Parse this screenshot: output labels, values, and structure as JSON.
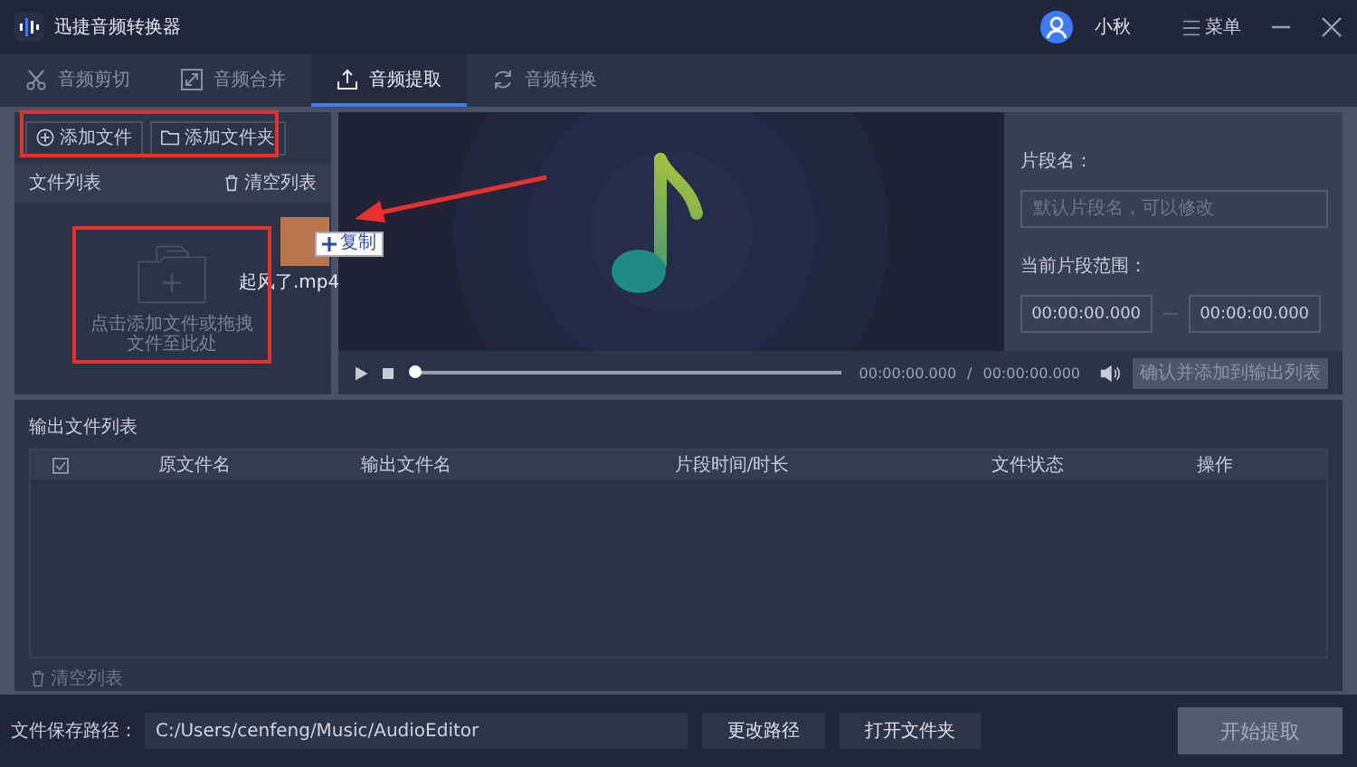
{
  "window": {
    "title": "迅捷音频转换器",
    "user": "小秋",
    "menu_label": "菜单"
  },
  "tabs": [
    {
      "label": "音频剪切",
      "kind": "scissors",
      "selected": false
    },
    {
      "label": "音频合并",
      "kind": "merge",
      "selected": false
    },
    {
      "label": "音频提取",
      "kind": "extract",
      "selected": true
    },
    {
      "label": "音频转换",
      "kind": "convert",
      "selected": false
    }
  ],
  "file_panel": {
    "buttons": [
      {
        "label": "添加文件",
        "kind": "file"
      },
      {
        "label": "添加文件夹",
        "kind": "folder"
      }
    ],
    "title": "文件列表",
    "clear": "清空列表",
    "dropzone_hint": "点击添加文件或拖拽文件至此处",
    "dragged_file": {
      "name": "起风了.mp4",
      "tooltip": "复制"
    }
  },
  "player": {
    "current_time": "00:00:00.000",
    "separator": "/",
    "total_time": "00:00:00.000",
    "progress": {
      "level": 0
    },
    "confirm_button": {
      "label": "确认并添加到输出列表",
      "disabled": true
    }
  },
  "segment": {
    "name_label": "片段名：",
    "name_field": {
      "placeholder": "默认片段名，可以修改"
    },
    "range_label": "当前片段范围：",
    "range_start": "00:00:00.000",
    "range_end": "00:00:00.000"
  },
  "output": {
    "title": "输出文件列表",
    "header_checkbox": {
      "checked": true
    },
    "columns": [
      "原文件名",
      "输出文件名",
      "片段时间/时长",
      "文件状态",
      "操作"
    ],
    "clear": "清空列表"
  },
  "footer": {
    "path_label": "文件保存路径：",
    "path": "C:/Users/cenfeng/Music/AudioEditor",
    "buttons": [
      "更改路径",
      "打开文件夹"
    ],
    "start_button": {
      "label": "开始提取",
      "disabled": true
    }
  }
}
